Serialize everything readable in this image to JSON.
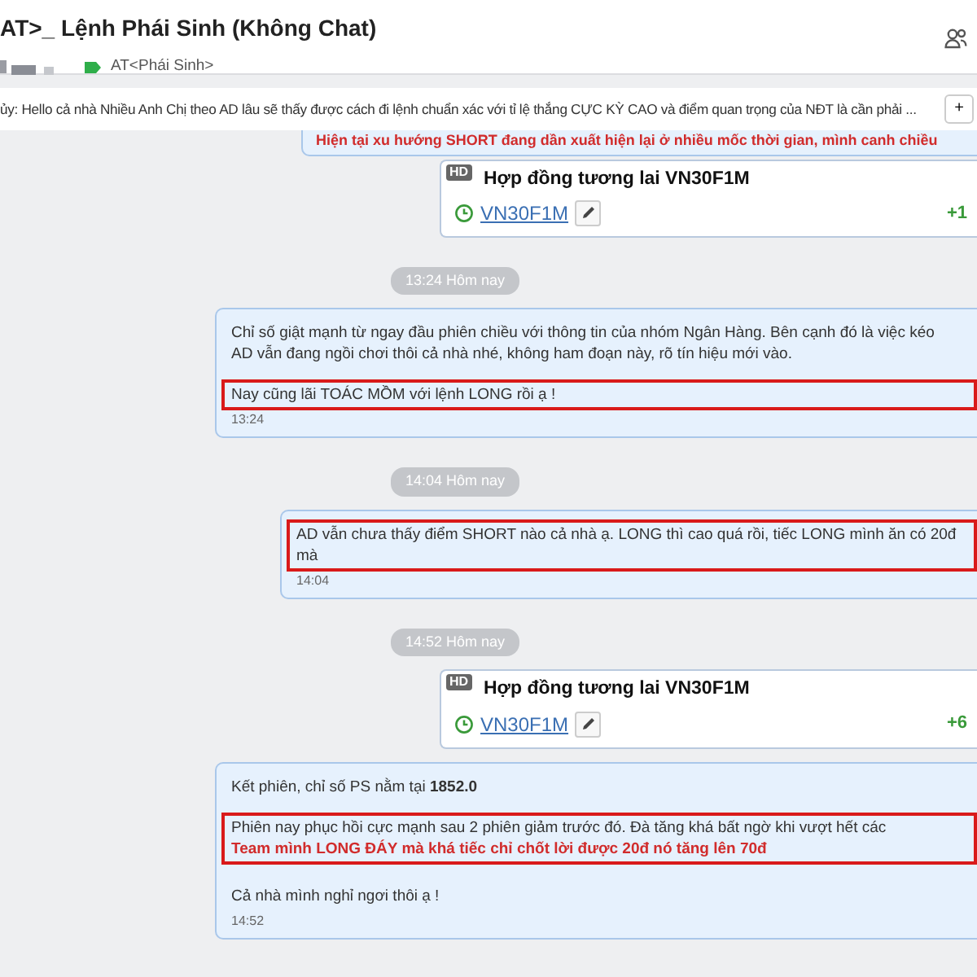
{
  "header": {
    "title": "AT>_ Lệnh Phái Sinh (Không Chat)",
    "tag": "AT<Phái Sinh>"
  },
  "notice": {
    "text": "ủy: Hello cả nhà Nhiều Anh Chị theo AD lâu sẽ thấy được cách đi lệnh chuẩn xác với tỉ lệ thắng CỰC KỲ CAO và điểm quan trọng của NĐT là cần phải ...",
    "button": "+"
  },
  "chat": [
    {
      "kind": "partial",
      "text": "Hiện tại xu hướng SHORT đang dần xuất hiện lại ở nhiều mốc thời gian, mình canh chiều"
    },
    {
      "kind": "card",
      "badge": "HD",
      "title": "Hợp đồng tương lai VN30F1M",
      "symbol": "VN30F1M",
      "change": "+1"
    },
    {
      "kind": "time",
      "text": "13:24 Hôm nay"
    },
    {
      "kind": "bubble",
      "paragraphs": [
        {
          "highlighted": false,
          "lines": [
            {
              "kind": "normal",
              "text": "Chỉ số giật mạnh từ ngay đầu phiên chiều với thông tin của nhóm Ngân Hàng. Bên cạnh đó là việc kéo"
            },
            {
              "kind": "normal",
              "text": "AD vẫn đang ngồi chơi thôi cả nhà nhé, không ham đoạn này, rõ tín hiệu mới vào."
            }
          ]
        },
        {
          "highlighted": true,
          "lines": [
            {
              "kind": "normal",
              "text": "Nay cũng lãi TOÁC MỒM với lệnh LONG rồi ạ !"
            }
          ]
        }
      ],
      "time": "13:24"
    },
    {
      "kind": "time",
      "text": "14:04 Hôm nay"
    },
    {
      "kind": "bubble",
      "paragraphs": [
        {
          "highlighted": true,
          "lines": [
            {
              "kind": "normal",
              "text": "AD vẫn chưa thấy điểm SHORT nào cả nhà ạ. LONG thì cao quá rồi, tiếc LONG mình ăn có 20đ mà"
            }
          ]
        }
      ],
      "time": "14:04"
    },
    {
      "kind": "time",
      "text": "14:52 Hôm nay"
    },
    {
      "kind": "card",
      "badge": "HD",
      "title": "Hợp đồng tương lai VN30F1M",
      "symbol": "VN30F1M",
      "change": "+6"
    },
    {
      "kind": "bubble",
      "paragraphs": [
        {
          "highlighted": false,
          "lines": [
            {
              "kind": "normal",
              "text": "Kết phiên, chỉ số PS nằm tại **1852.0**"
            }
          ]
        },
        {
          "highlighted": true,
          "lines": [
            {
              "kind": "normal",
              "text": "Phiên nay phục hồi cực mạnh sau 2 phiên giảm trước đó. Đà tăng khá bất ngờ khi vượt hết các"
            },
            {
              "kind": "alert",
              "text": "Team mình LONG ĐÁY mà khá tiếc chỉ chốt lời được 20đ nó tăng lên 70đ"
            }
          ]
        },
        {
          "highlighted": false,
          "lines": [
            {
              "kind": "normal",
              "text": "Cả nhà mình nghỉ ngơi thôi ạ !"
            }
          ]
        }
      ],
      "time": "14:52"
    }
  ]
}
